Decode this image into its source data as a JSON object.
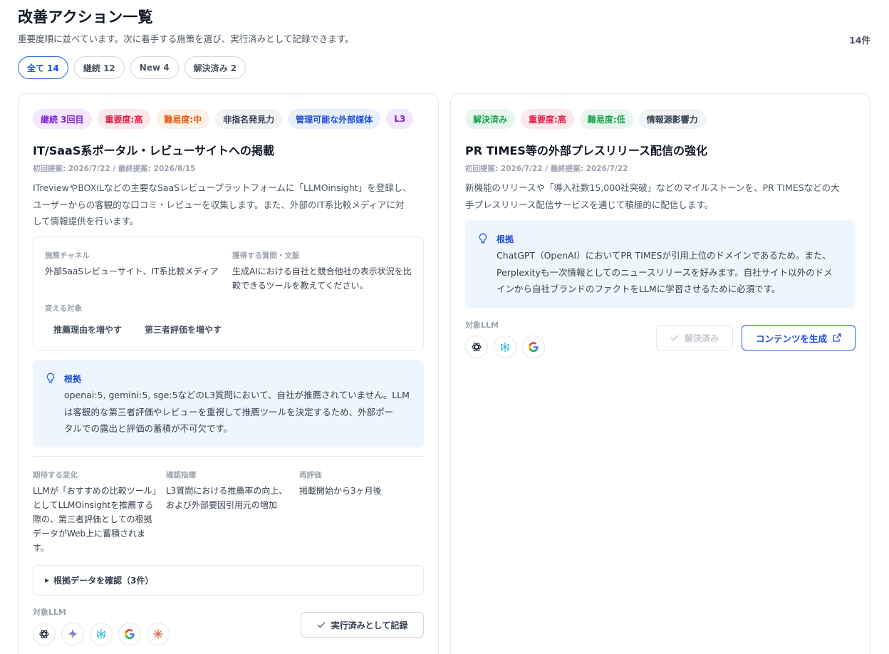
{
  "page": {
    "title": "改善アクション一覧",
    "subtitle": "重要度順に並べています。次に着手する施策を選び、実行済みとして記録できます。",
    "count": "14件"
  },
  "filters": [
    {
      "label": "全て 14",
      "active": true
    },
    {
      "label": "継続 12",
      "active": false
    },
    {
      "label": "New 4",
      "active": false
    },
    {
      "label": "解決済み 2",
      "active": false
    }
  ],
  "cards": [
    {
      "tags": [
        "継続 3回目",
        "重要度:高",
        "難易度:中",
        "非指名発見力",
        "管理可能な外部媒体",
        "L3"
      ],
      "title": "IT/SaaS系ポータル・レビューサイトへの掲載",
      "dates": "初回提案: 2026/7/22 / 最終提案: 2026/8/15",
      "description": [
        "ITreviewやBOXILなどの主要なSaaSレビュープラットフォームに「LLMOinsight」を登録し、",
        "ユーザーからの客観的な口コミ・レビューを収集します。また、外部のIT系比較メディアに対",
        "して情報提供を行います。"
      ],
      "channel_label": "施策チャネル",
      "channel_value": "外部SaaSレビューサイト、IT系比較メディア",
      "question_label": "獲得する質問・文脈",
      "question_value": [
        "生成AIにおける自社と競合他社の表示状況を比",
        "較できるツールを教えてください。"
      ],
      "target_label": "変える対象",
      "targets": [
        "推薦理由を増やす",
        "第三者評価を増やす"
      ],
      "basis_title": "根拠",
      "basis_text": [
        "openai:5, gemini:5, sge:5などのL3質問において、自社が推薦されていません。LLM",
        "は客観的な第三者評価やレビューを重視して推薦ツールを決定するため、外部ポー",
        "タルでの露出と評価の蓄積が不可欠です。"
      ],
      "expected_label": "期待する変化",
      "expected_value": [
        "LLMが「おすすめの比較ツール」",
        "としてLLMOinsightを推薦する",
        "際の、第三者評価としての根拠",
        "データがWeb上に蓄積されま",
        "す。"
      ],
      "metric_label": "確認指標",
      "metric_value": [
        "L3質問における推薦率の向上、",
        "および外部要因引用元の増加"
      ],
      "review_label": "再評価",
      "review_value": "掲載開始から3ヶ月後",
      "evidence_toggle": "根拠データを確認（3件）",
      "llm_label": "対象LLM",
      "llms": [
        "chatgpt-icon",
        "gemini-icon",
        "perplexity-icon",
        "google-icon",
        "claude-icon"
      ],
      "action_button": "実行済みとして記録"
    },
    {
      "tags": [
        "解決済み",
        "重要度:高",
        "難易度:低",
        "情報源影響力"
      ],
      "title": "PR TIMES等の外部プレスリリース配信の強化",
      "dates": "初回提案: 2026/7/22 / 最終提案: 2026/7/22",
      "description": [
        "新機能のリリースや「導入社数15,000社突破」などのマイルストーンを、PR TIMESなどの大",
        "手プレスリリース配信サービスを通じて積極的に配信します。"
      ],
      "basis_title": "根拠",
      "basis_text": [
        "ChatGPT（OpenAI）においてPR TIMESが引用上位のドメインであるため。また、",
        "Perplexityも一次情報としてのニュースリリースを好みます。自社サイト以外のドメ",
        "インから自社ブランドのファクトをLLMに学習させるために必須です。"
      ],
      "llm_label": "対象LLM",
      "llms": [
        "chatgpt-icon",
        "perplexity-icon",
        "google-icon"
      ],
      "resolved_button": "解決済み",
      "generate_button": "コンテンツを生成"
    }
  ]
}
